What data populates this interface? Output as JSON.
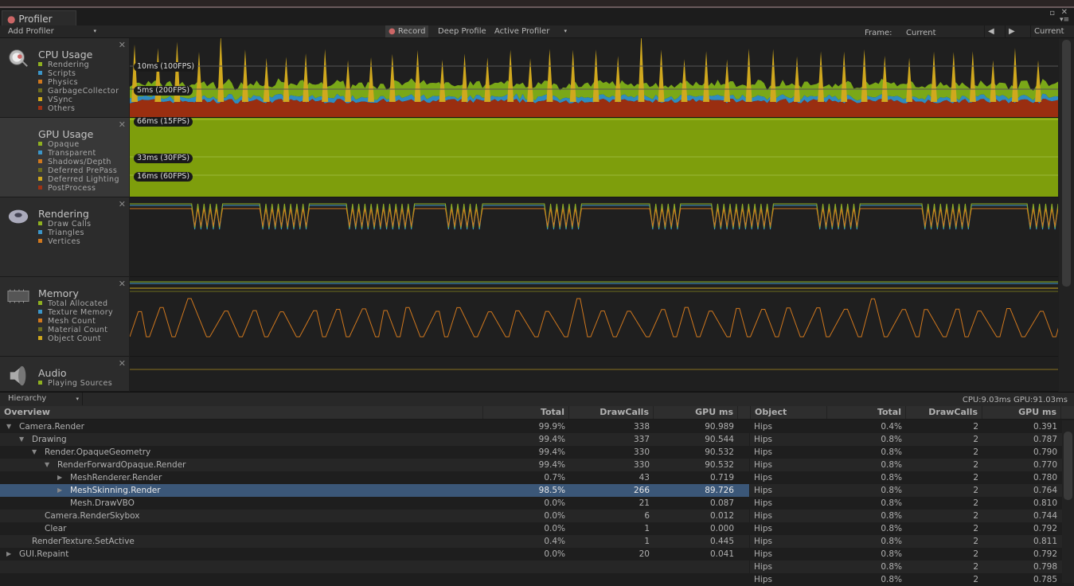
{
  "window": {
    "tab": "Profiler"
  },
  "toolbar": {
    "add_profiler": "Add Profiler",
    "record": "Record",
    "deep_profile": "Deep Profile",
    "active_profiler": "Active Profiler",
    "frame_label": "Frame:",
    "frame_value": "Current",
    "current": "Current"
  },
  "modules": [
    {
      "title": "CPU Usage",
      "icon": "cpu-stopwatch-icon",
      "legend": [
        {
          "l": "Rendering",
          "c": "#8fb020"
        },
        {
          "l": "Scripts",
          "c": "#3c96c8"
        },
        {
          "l": "Physics",
          "c": "#d0781e"
        },
        {
          "l": "GarbageCollector",
          "c": "#6e6e1e"
        },
        {
          "l": "VSync",
          "c": "#d0a81e"
        },
        {
          "l": "Others",
          "c": "#a03214"
        }
      ],
      "labels": [
        "10ms (100FPS)",
        "5ms (200FPS)"
      ]
    },
    {
      "title": "GPU Usage",
      "icon": "gpu-icon",
      "legend": [
        {
          "l": "Opaque",
          "c": "#8fb020"
        },
        {
          "l": "Transparent",
          "c": "#3c96c8"
        },
        {
          "l": "Shadows/Depth",
          "c": "#d0781e"
        },
        {
          "l": "Deferred PrePass",
          "c": "#6e6e1e"
        },
        {
          "l": "Deferred Lighting",
          "c": "#d0a81e"
        },
        {
          "l": "PostProcess",
          "c": "#a03214"
        }
      ],
      "labels": [
        "66ms (15FPS)",
        "33ms (30FPS)",
        "16ms (60FPS)"
      ]
    },
    {
      "title": "Rendering",
      "icon": "rendering-torus-icon",
      "legend": [
        {
          "l": "Draw Calls",
          "c": "#8fb020"
        },
        {
          "l": "Triangles",
          "c": "#3c96c8"
        },
        {
          "l": "Vertices",
          "c": "#d0781e"
        }
      ]
    },
    {
      "title": "Memory",
      "icon": "memory-chip-icon",
      "legend": [
        {
          "l": "Total Allocated",
          "c": "#8fb020"
        },
        {
          "l": "Texture Memory",
          "c": "#3c96c8"
        },
        {
          "l": "Mesh Count",
          "c": "#d0781e"
        },
        {
          "l": "Material Count",
          "c": "#6e6e1e"
        },
        {
          "l": "Object Count",
          "c": "#d0a81e"
        }
      ]
    },
    {
      "title": "Audio",
      "icon": "audio-speaker-icon",
      "legend": [
        {
          "l": "Playing Sources",
          "c": "#8fb020"
        }
      ]
    }
  ],
  "hierarchy": {
    "mode": "Hierarchy",
    "stats": "CPU:9.03ms  GPU:91.03ms",
    "columns": [
      "Overview",
      "Total",
      "DrawCalls",
      "GPU ms"
    ],
    "rows": [
      {
        "name": "Camera.Render",
        "indent": 0,
        "arrow": "down",
        "total": "99.9%",
        "dc": "338",
        "gpu": "90.989"
      },
      {
        "name": "Drawing",
        "indent": 1,
        "arrow": "down",
        "total": "99.4%",
        "dc": "337",
        "gpu": "90.544"
      },
      {
        "name": "Render.OpaqueGeometry",
        "indent": 2,
        "arrow": "down",
        "total": "99.4%",
        "dc": "330",
        "gpu": "90.532"
      },
      {
        "name": "RenderForwardOpaque.Render",
        "indent": 3,
        "arrow": "down",
        "total": "99.4%",
        "dc": "330",
        "gpu": "90.532"
      },
      {
        "name": "MeshRenderer.Render",
        "indent": 4,
        "arrow": "right",
        "total": "0.7%",
        "dc": "43",
        "gpu": "0.719"
      },
      {
        "name": "MeshSkinning.Render",
        "indent": 4,
        "arrow": "right",
        "total": "98.5%",
        "dc": "266",
        "gpu": "89.726",
        "selected": true
      },
      {
        "name": "Mesh.DrawVBO",
        "indent": 4,
        "arrow": "",
        "total": "0.0%",
        "dc": "21",
        "gpu": "0.087"
      },
      {
        "name": "Camera.RenderSkybox",
        "indent": 2,
        "arrow": "",
        "total": "0.0%",
        "dc": "6",
        "gpu": "0.012"
      },
      {
        "name": "Clear",
        "indent": 2,
        "arrow": "",
        "total": "0.0%",
        "dc": "1",
        "gpu": "0.000"
      },
      {
        "name": "RenderTexture.SetActive",
        "indent": 1,
        "arrow": "",
        "total": "0.4%",
        "dc": "1",
        "gpu": "0.445"
      },
      {
        "name": "GUI.Repaint",
        "indent": 0,
        "arrow": "right",
        "total": "0.0%",
        "dc": "20",
        "gpu": "0.041"
      }
    ]
  },
  "objects": {
    "columns": [
      "Object",
      "Total",
      "DrawCalls",
      "GPU ms"
    ],
    "rows": [
      [
        "Hips",
        "0.4%",
        "2",
        "0.391"
      ],
      [
        "Hips",
        "0.8%",
        "2",
        "0.787"
      ],
      [
        "Hips",
        "0.8%",
        "2",
        "0.790"
      ],
      [
        "Hips",
        "0.8%",
        "2",
        "0.770"
      ],
      [
        "Hips",
        "0.8%",
        "2",
        "0.780"
      ],
      [
        "Hips",
        "0.8%",
        "2",
        "0.764"
      ],
      [
        "Hips",
        "0.8%",
        "2",
        "0.810"
      ],
      [
        "Hips",
        "0.8%",
        "2",
        "0.744"
      ],
      [
        "Hips",
        "0.8%",
        "2",
        "0.792"
      ],
      [
        "Hips",
        "0.8%",
        "2",
        "0.811"
      ],
      [
        "Hips",
        "0.8%",
        "2",
        "0.792"
      ],
      [
        "Hips",
        "0.8%",
        "2",
        "0.798"
      ],
      [
        "Hips",
        "0.8%",
        "2",
        "0.785"
      ]
    ]
  }
}
